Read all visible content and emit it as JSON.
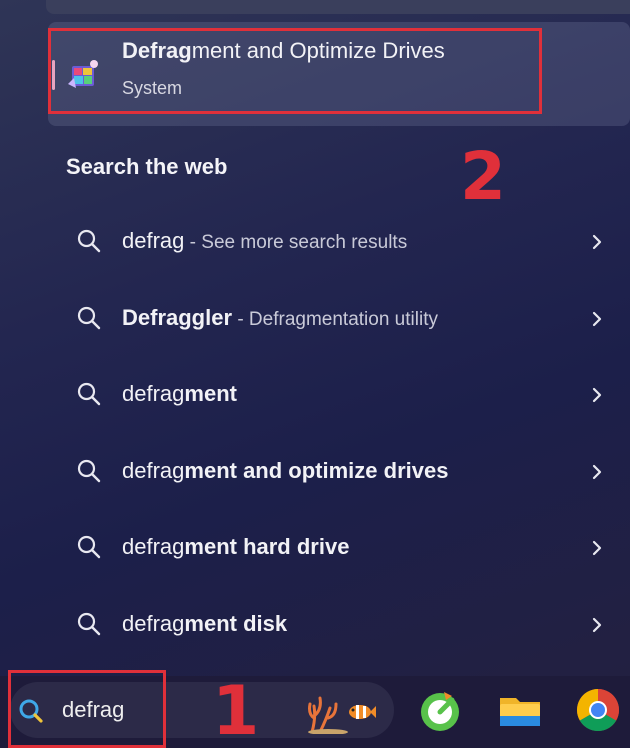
{
  "best_match": {
    "title_bold": "Defrag",
    "title_rest": "ment and Optimize Drives",
    "subtitle": "System"
  },
  "web_section": {
    "title": "Search the web"
  },
  "results": [
    {
      "bold": "",
      "normal": "defrag",
      "suffix": " - See more search results"
    },
    {
      "bold": "Defraggler",
      "normal": "",
      "suffix": " - Defragmentation utility"
    },
    {
      "normal": "defrag",
      "bold": "ment",
      "suffix": ""
    },
    {
      "normal": "defrag",
      "bold": "ment and optimize drives",
      "suffix": ""
    },
    {
      "normal": "defrag",
      "bold": "ment hard drive",
      "suffix": ""
    },
    {
      "normal": "defrag",
      "bold": "ment disk",
      "suffix": ""
    }
  ],
  "taskbar": {
    "search_value": "defrag"
  },
  "annotations": {
    "label_1": "1",
    "label_2": "2"
  },
  "colors": {
    "annotation_red": "#e0303a",
    "background": "#232650"
  }
}
